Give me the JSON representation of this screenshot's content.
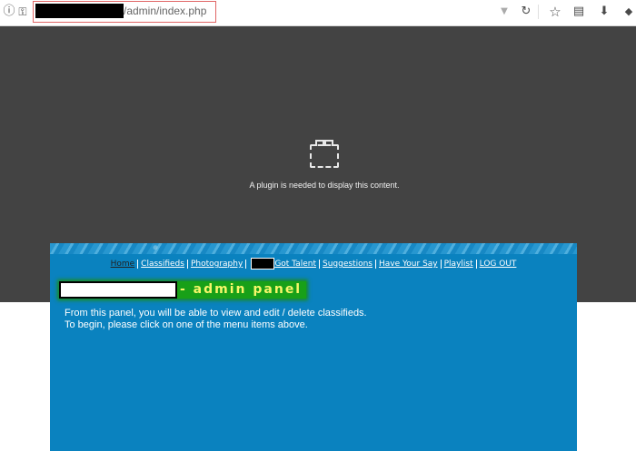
{
  "browser": {
    "url_suffix": "/admin/index.php",
    "icons": {
      "info": "info-icon",
      "key": "key-icon",
      "dropdown": "chevron-down-icon",
      "reload": "reload-icon",
      "bookmark": "star-icon",
      "clipboard": "clipboard-icon",
      "download": "download-icon",
      "more": "more-icon"
    }
  },
  "plugin": {
    "message": "A plugin is needed to display this content."
  },
  "site": {
    "nav": {
      "home": "Home",
      "classifieds": "Classifieds",
      "photography": "Photography",
      "got_talent": "Got Talent",
      "suggestions": "Suggestions",
      "have_your_say": "Have Your Say",
      "playlist": "Playlist",
      "logout": "LOG OUT"
    },
    "title_suffix": "- admin panel",
    "intro_line1": "From this panel, you will be able to view and edit / delete classifieds.",
    "intro_line2": "To begin, please click on one of the menu items above."
  },
  "colors": {
    "panel_bg": "#0a82bf",
    "plugin_bg": "#434343",
    "title_bg": "#18a018",
    "title_text": "#f7f76a",
    "url_highlight": "#e06666"
  }
}
